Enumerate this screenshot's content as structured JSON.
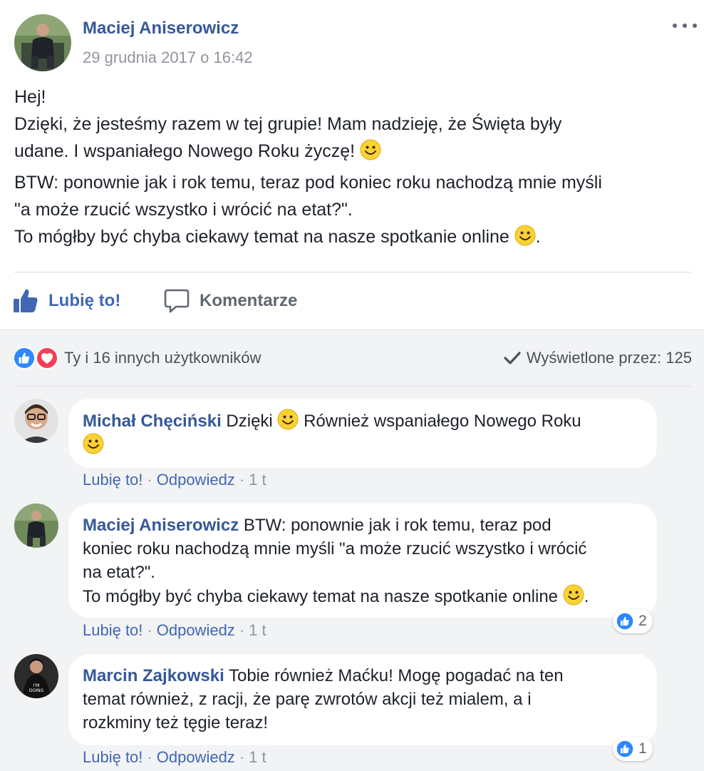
{
  "post": {
    "author": "Maciej Aniserowicz",
    "time": "29 grudnia 2017 o 16:42",
    "para1_line1": "Hej!",
    "para1_line2": "Dzięki, że jesteśmy razem w tej grupie! Mam nadzieję, że Święta były",
    "para1_line3": "udane. I wspaniałego Nowego Roku życzę!",
    "para2_line1": "BTW: ponownie jak i rok temu, teraz pod koniec roku nachodzą mnie myśli",
    "para2_line2": "\"a może rzucić wszystko i wrócić na etat?\".",
    "para2_line3": "To mógłby być chyba ciekawy temat na nasze spotkanie online",
    "para2_end": "."
  },
  "actions": {
    "like_label": "Lubię to!",
    "comment_label": "Komentarze"
  },
  "reactions": {
    "summary": "Ty i 16 innych użytkowników",
    "seen": "Wyświetlone przez: 125"
  },
  "comments": [
    {
      "author": "Michał Chęciński",
      "text_a": "Dzięki",
      "text_b": "Również wspaniałego Nowego Roku",
      "like": "Lubię to!",
      "reply": "Odpowiedz",
      "age": "1 t"
    },
    {
      "author": "Maciej Aniserowicz",
      "text_line1": "BTW: ponownie jak i rok temu, teraz pod",
      "text_line2": "koniec roku nachodzą mnie myśli \"a może rzucić wszystko i wrócić",
      "text_line3": "na etat?\".",
      "text_line4": "To mógłby być chyba ciekawy temat na nasze spotkanie online",
      "text_end": ".",
      "reaction_count": "2",
      "like": "Lubię to!",
      "reply": "Odpowiedz",
      "age": "1 t"
    },
    {
      "author": "Marcin Zajkowski",
      "text_line1": "Tobie również Maćku! Mogę pogadać na ten",
      "text_line2": "temat również, z racji, że parę zwrotów akcji też mialem, a i",
      "text_line3": "rozkminy też tęgie teraz!",
      "reaction_count": "1",
      "like": "Lubię to!",
      "reply": "Odpowiedz",
      "age": "1 t"
    }
  ],
  "colors": {
    "link": "#365899",
    "accent": "#4267b2",
    "muted": "#90949c",
    "comments_bg": "#f2f3f5",
    "like_blue": "#2d88ff",
    "love_red": "#f33e58"
  },
  "icons": [
    "avatar",
    "more-dots-icon",
    "thumbs-up-icon",
    "comment-bubble-icon",
    "like-reaction-icon",
    "love-reaction-icon",
    "checkmark-icon",
    "smiley-emoji-icon"
  ]
}
